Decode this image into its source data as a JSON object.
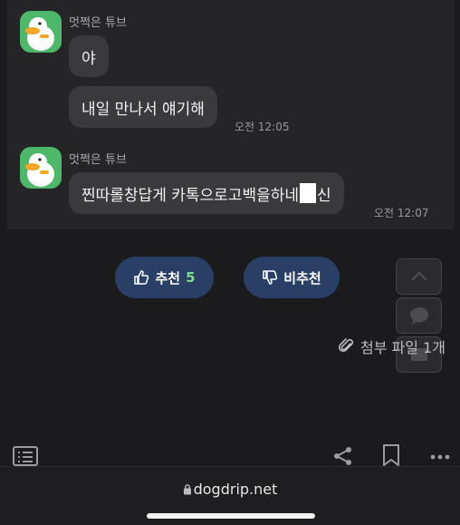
{
  "chat": {
    "messages": [
      {
        "sender": "멋쩍은 튜브",
        "bubbles": [
          "야",
          "내일 만나서 얘기해"
        ],
        "time": "오전 12:05"
      },
      {
        "sender": "멋쩍은 튜브",
        "text_before": "찐따롤창답게 카톡으로고백을하네",
        "text_after": "신",
        "time": "오전 12:07"
      }
    ]
  },
  "vote": {
    "recommend_label": "추천",
    "recommend_count": "5",
    "not_recommend_label": "비추천"
  },
  "attachment": {
    "label": "첨부 파일 1개"
  },
  "browser": {
    "url": "dogdrip.net"
  },
  "colors": {
    "vote_button_bg": "#2a3f66",
    "count_accent": "#7ee08a",
    "avatar_bg": "#4eb86a"
  }
}
